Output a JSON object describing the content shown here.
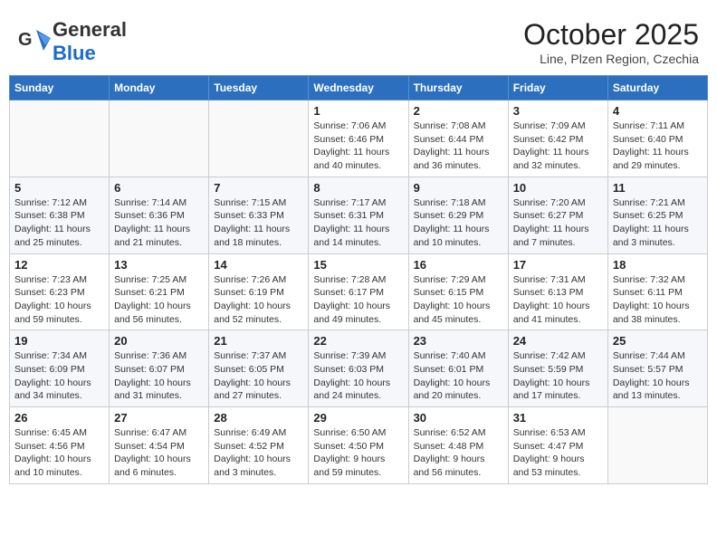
{
  "header": {
    "logo_general": "General",
    "logo_blue": "Blue",
    "month_title": "October 2025",
    "subtitle": "Line, Plzen Region, Czechia"
  },
  "days_of_week": [
    "Sunday",
    "Monday",
    "Tuesday",
    "Wednesday",
    "Thursday",
    "Friday",
    "Saturday"
  ],
  "weeks": [
    [
      {
        "day": "",
        "info": ""
      },
      {
        "day": "",
        "info": ""
      },
      {
        "day": "",
        "info": ""
      },
      {
        "day": "1",
        "info": "Sunrise: 7:06 AM\nSunset: 6:46 PM\nDaylight: 11 hours\nand 40 minutes."
      },
      {
        "day": "2",
        "info": "Sunrise: 7:08 AM\nSunset: 6:44 PM\nDaylight: 11 hours\nand 36 minutes."
      },
      {
        "day": "3",
        "info": "Sunrise: 7:09 AM\nSunset: 6:42 PM\nDaylight: 11 hours\nand 32 minutes."
      },
      {
        "day": "4",
        "info": "Sunrise: 7:11 AM\nSunset: 6:40 PM\nDaylight: 11 hours\nand 29 minutes."
      }
    ],
    [
      {
        "day": "5",
        "info": "Sunrise: 7:12 AM\nSunset: 6:38 PM\nDaylight: 11 hours\nand 25 minutes."
      },
      {
        "day": "6",
        "info": "Sunrise: 7:14 AM\nSunset: 6:36 PM\nDaylight: 11 hours\nand 21 minutes."
      },
      {
        "day": "7",
        "info": "Sunrise: 7:15 AM\nSunset: 6:33 PM\nDaylight: 11 hours\nand 18 minutes."
      },
      {
        "day": "8",
        "info": "Sunrise: 7:17 AM\nSunset: 6:31 PM\nDaylight: 11 hours\nand 14 minutes."
      },
      {
        "day": "9",
        "info": "Sunrise: 7:18 AM\nSunset: 6:29 PM\nDaylight: 11 hours\nand 10 minutes."
      },
      {
        "day": "10",
        "info": "Sunrise: 7:20 AM\nSunset: 6:27 PM\nDaylight: 11 hours\nand 7 minutes."
      },
      {
        "day": "11",
        "info": "Sunrise: 7:21 AM\nSunset: 6:25 PM\nDaylight: 11 hours\nand 3 minutes."
      }
    ],
    [
      {
        "day": "12",
        "info": "Sunrise: 7:23 AM\nSunset: 6:23 PM\nDaylight: 10 hours\nand 59 minutes."
      },
      {
        "day": "13",
        "info": "Sunrise: 7:25 AM\nSunset: 6:21 PM\nDaylight: 10 hours\nand 56 minutes."
      },
      {
        "day": "14",
        "info": "Sunrise: 7:26 AM\nSunset: 6:19 PM\nDaylight: 10 hours\nand 52 minutes."
      },
      {
        "day": "15",
        "info": "Sunrise: 7:28 AM\nSunset: 6:17 PM\nDaylight: 10 hours\nand 49 minutes."
      },
      {
        "day": "16",
        "info": "Sunrise: 7:29 AM\nSunset: 6:15 PM\nDaylight: 10 hours\nand 45 minutes."
      },
      {
        "day": "17",
        "info": "Sunrise: 7:31 AM\nSunset: 6:13 PM\nDaylight: 10 hours\nand 41 minutes."
      },
      {
        "day": "18",
        "info": "Sunrise: 7:32 AM\nSunset: 6:11 PM\nDaylight: 10 hours\nand 38 minutes."
      }
    ],
    [
      {
        "day": "19",
        "info": "Sunrise: 7:34 AM\nSunset: 6:09 PM\nDaylight: 10 hours\nand 34 minutes."
      },
      {
        "day": "20",
        "info": "Sunrise: 7:36 AM\nSunset: 6:07 PM\nDaylight: 10 hours\nand 31 minutes."
      },
      {
        "day": "21",
        "info": "Sunrise: 7:37 AM\nSunset: 6:05 PM\nDaylight: 10 hours\nand 27 minutes."
      },
      {
        "day": "22",
        "info": "Sunrise: 7:39 AM\nSunset: 6:03 PM\nDaylight: 10 hours\nand 24 minutes."
      },
      {
        "day": "23",
        "info": "Sunrise: 7:40 AM\nSunset: 6:01 PM\nDaylight: 10 hours\nand 20 minutes."
      },
      {
        "day": "24",
        "info": "Sunrise: 7:42 AM\nSunset: 5:59 PM\nDaylight: 10 hours\nand 17 minutes."
      },
      {
        "day": "25",
        "info": "Sunrise: 7:44 AM\nSunset: 5:57 PM\nDaylight: 10 hours\nand 13 minutes."
      }
    ],
    [
      {
        "day": "26",
        "info": "Sunrise: 6:45 AM\nSunset: 4:56 PM\nDaylight: 10 hours\nand 10 minutes."
      },
      {
        "day": "27",
        "info": "Sunrise: 6:47 AM\nSunset: 4:54 PM\nDaylight: 10 hours\nand 6 minutes."
      },
      {
        "day": "28",
        "info": "Sunrise: 6:49 AM\nSunset: 4:52 PM\nDaylight: 10 hours\nand 3 minutes."
      },
      {
        "day": "29",
        "info": "Sunrise: 6:50 AM\nSunset: 4:50 PM\nDaylight: 9 hours\nand 59 minutes."
      },
      {
        "day": "30",
        "info": "Sunrise: 6:52 AM\nSunset: 4:48 PM\nDaylight: 9 hours\nand 56 minutes."
      },
      {
        "day": "31",
        "info": "Sunrise: 6:53 AM\nSunset: 4:47 PM\nDaylight: 9 hours\nand 53 minutes."
      },
      {
        "day": "",
        "info": ""
      }
    ]
  ]
}
